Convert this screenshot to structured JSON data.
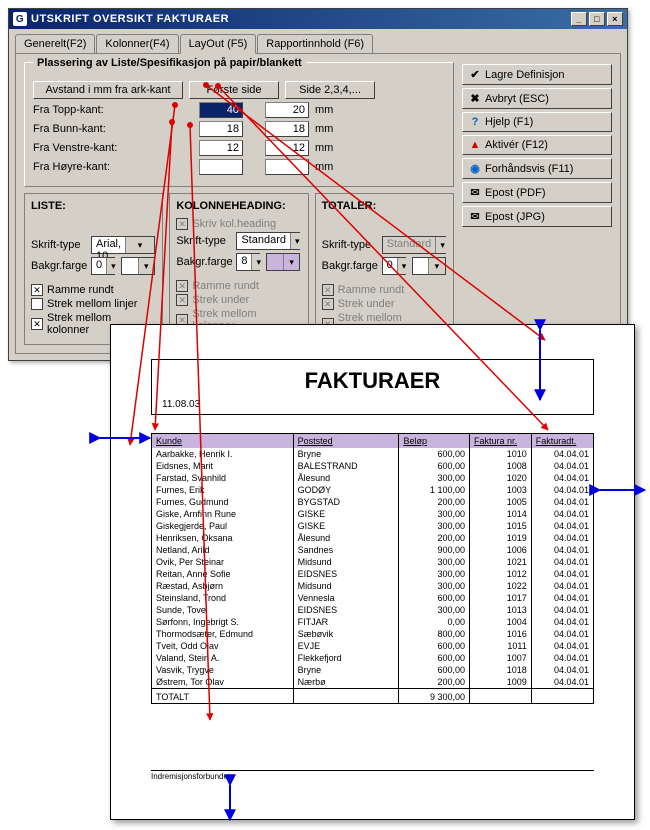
{
  "window": {
    "title": "UTSKRIFT OVERSIKT FAKTURAER",
    "icon": "G"
  },
  "tabs": {
    "generelt": "Generelt(F2)",
    "kolonner": "Kolonner(F4)",
    "layout": "LayOut (F5)",
    "rapport": "Rapportinnhold (F6)"
  },
  "placement": {
    "group_title": "Plassering av Liste/Spesifikasjon på papir/blankett",
    "avstand_btn": "Avstand i mm fra ark-kant",
    "forste_side_btn": "Første side",
    "side234_btn": "Side 2,3,4,...",
    "rows": {
      "topp": {
        "label": "Fra Topp-kant:",
        "v1": "40",
        "v2": "20",
        "unit": "mm"
      },
      "bunn": {
        "label": "Fra Bunn-kant:",
        "v1": "18",
        "v2": "18",
        "unit": "mm"
      },
      "venstre": {
        "label": "Fra Venstre-kant:",
        "v1": "12",
        "v2": "12",
        "unit": "mm"
      },
      "hoyre": {
        "label": "Fra Høyre-kant:",
        "v1": "",
        "v2": "",
        "unit": "mm"
      }
    }
  },
  "sidebuttons": {
    "lagre": "Lagre Definisjon",
    "avbryt": "Avbryt (ESC)",
    "hjelp": "Hjelp (F1)",
    "aktiver": "Aktivér (F12)",
    "forhands": "Forhåndsvis (F11)",
    "epostpdf": "Epost (PDF)",
    "epostjpg": "Epost (JPG)"
  },
  "liste": {
    "title": "LISTE:",
    "skrift_label": "Skrift-type",
    "skrift_value": "Arial, 10",
    "bakgr_label": "Bakgr.farge",
    "bakgr_value": "0",
    "ramme": "Ramme rundt",
    "strek_linjer": "Strek mellom linjer",
    "strek_kol": "Strek mellom kolonner"
  },
  "kolonne": {
    "title": "KOLONNEHEADING:",
    "skriv": "Skriv kol.heading",
    "skrift_label": "Skrift-type",
    "skrift_value": "Standard",
    "bakgr_label": "Bakgr.farge",
    "bakgr_value": "8",
    "ramme": "Ramme rundt",
    "strek_under": "Strek under",
    "strek_kol": "Strek mellom kolonner"
  },
  "totaler": {
    "title": "TOTALER:",
    "skrift_label": "Skrift-type",
    "skrift_value": "Standard",
    "bakgr_label": "Bakgr.farge",
    "bakgr_value": "0",
    "ramme": "Ramme rundt",
    "strek_under": "Strek under",
    "strek_kol": "Strek mellom kolonner"
  },
  "preview": {
    "title": "FAKTURAER",
    "date": "11.08.03",
    "columns": [
      "Kunde",
      "Poststed",
      "Beløp",
      "Faktura nr.",
      "Fakturadt."
    ],
    "rows": [
      [
        "Aarbakke, Henrik I.",
        "Bryne",
        "600,00",
        "1010",
        "04.04.01"
      ],
      [
        "Eidsnes, Marit",
        "BALESTRAND",
        "600,00",
        "1008",
        "04.04.01"
      ],
      [
        "Farstad, Svanhild",
        "Ålesund",
        "300,00",
        "1020",
        "04.04.01"
      ],
      [
        "Furnes, Erik",
        "GODØY",
        "1 100,00",
        "1003",
        "04.04.01"
      ],
      [
        "Furnes, Gudmund",
        "BYGSTAD",
        "200,00",
        "1005",
        "04.04.01"
      ],
      [
        "Giske, Arnfinn Rune",
        "GISKE",
        "300,00",
        "1014",
        "04.04.01"
      ],
      [
        "Giskegjerde, Paul",
        "GISKE",
        "300,00",
        "1015",
        "04.04.01"
      ],
      [
        "Henriksen, Oksana",
        "Ålesund",
        "200,00",
        "1019",
        "04.04.01"
      ],
      [
        "Netland, Arild",
        "Sandnes",
        "900,00",
        "1006",
        "04.04.01"
      ],
      [
        "Ovik, Per Steinar",
        "Midsund",
        "300,00",
        "1021",
        "04.04.01"
      ],
      [
        "Reitan, Anne Sofie",
        "EIDSNES",
        "300,00",
        "1012",
        "04.04.01"
      ],
      [
        "Ræstad, Asbjørn",
        "Midsund",
        "300,00",
        "1022",
        "04.04.01"
      ],
      [
        "Steinsland, Trond",
        "Vennesla",
        "600,00",
        "1017",
        "04.04.01"
      ],
      [
        "Sunde, Tove",
        "EIDSNES",
        "300,00",
        "1013",
        "04.04.01"
      ],
      [
        "Sørfonn, Ingebrigt S.",
        "FITJAR",
        "0,00",
        "1004",
        "04.04.01"
      ],
      [
        "Thormodsæter, Edmund",
        "Sæbøvik",
        "800,00",
        "1016",
        "04.04.01"
      ],
      [
        "Tveit, Odd Olav",
        "EVJE",
        "600,00",
        "1011",
        "04.04.01"
      ],
      [
        "Valand, Stein A.",
        "Flekkefjord",
        "600,00",
        "1007",
        "04.04.01"
      ],
      [
        "Vasvik, Trygve",
        "Bryne",
        "600,00",
        "1018",
        "04.04.01"
      ],
      [
        "Østrem, Tor Olav",
        "Nærbø",
        "200,00",
        "1009",
        "04.04.01"
      ]
    ],
    "total_label": "TOTALT",
    "total_value": "9 300,00",
    "footer": "Indremisjonsforbundet"
  }
}
